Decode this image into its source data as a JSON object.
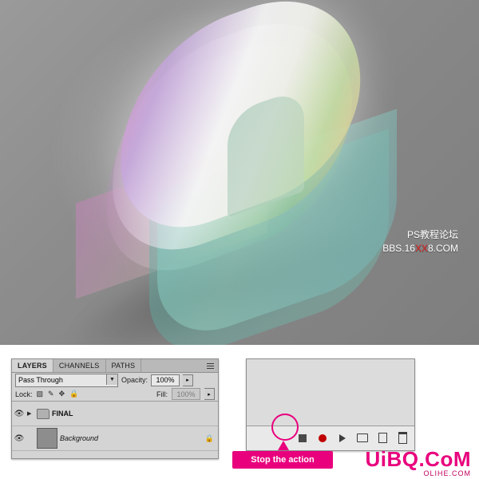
{
  "artwork": {
    "watermark_line1": "PS教程论坛",
    "watermark_line2_a": "BBS.16",
    "watermark_line2_red": "XX",
    "watermark_line2_b": "8.COM"
  },
  "layers_panel": {
    "tabs": [
      {
        "label": "LAYERS",
        "active": true
      },
      {
        "label": "CHANNELS",
        "active": false
      },
      {
        "label": "PATHS",
        "active": false
      }
    ],
    "menu_icon": "panel-menu-icon",
    "blend_mode": "Pass Through",
    "blend_dropdown_icon": "▼",
    "opacity_label": "Opacity:",
    "opacity_value": "100%",
    "opacity_spinner_icon": "▸",
    "lock_label": "Lock:",
    "lock_icons": [
      "transparency-lock-icon",
      "brush-lock-icon",
      "move-lock-icon",
      "all-lock-icon"
    ],
    "fill_label": "Fill:",
    "fill_value": "100%",
    "fill_spinner_icon": "▸",
    "layers": [
      {
        "visible_icon": "eye-icon",
        "expand_icon": "▶",
        "type": "group",
        "name": "FINAL",
        "locked": false
      },
      {
        "visible_icon": "eye-icon",
        "expand_icon": "",
        "type": "layer",
        "name": "Background",
        "locked": true,
        "lock_icon": "lock-icon"
      }
    ]
  },
  "actions_panel": {
    "buttons": [
      {
        "name": "stop-playing-button",
        "icon": "stop-square-icon"
      },
      {
        "name": "begin-recording-button",
        "icon": "record-circle-icon"
      },
      {
        "name": "play-selection-button",
        "icon": "play-triangle-icon"
      },
      {
        "name": "create-new-set-button",
        "icon": "folder-icon"
      },
      {
        "name": "create-new-action-button",
        "icon": "new-page-icon"
      },
      {
        "name": "delete-button",
        "icon": "trash-icon"
      }
    ]
  },
  "callout": {
    "label": "Stop the action",
    "highlight_color": "#e8007d"
  },
  "site_watermark": {
    "main": "UiBQ.CoM",
    "sub": "OLIHE.COM"
  }
}
